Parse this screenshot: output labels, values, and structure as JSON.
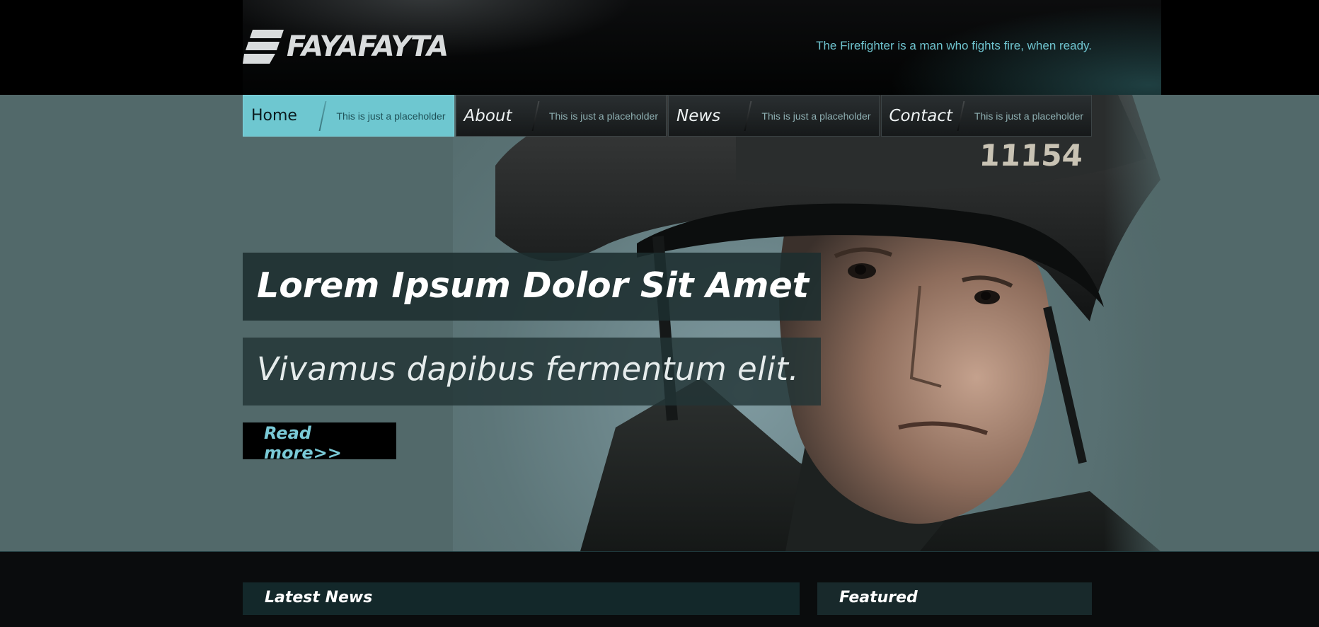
{
  "header": {
    "logo_text": "FAYAFAYTA",
    "tagline": "The Firefighter is a man who fights fire, when ready."
  },
  "nav": {
    "items": [
      {
        "label": "Home",
        "sub": "This is just a placeholder",
        "active": true
      },
      {
        "label": "About",
        "sub": "This is just a placeholder",
        "active": false
      },
      {
        "label": "News",
        "sub": "This is just a placeholder",
        "active": false
      },
      {
        "label": "Contact",
        "sub": "This is just a placeholder",
        "active": false
      }
    ]
  },
  "hero": {
    "title": "Lorem Ipsum Dolor Sit Amet",
    "subtitle": "Vivamus dapibus fermentum elit.",
    "cta_label": "Read more>>",
    "helmet_number": "11154"
  },
  "sections": {
    "latest_news_title": "Latest News",
    "featured_title": "Featured"
  },
  "colors": {
    "accent": "#6ec7d0",
    "hero_bg": "#52696a",
    "tagline": "#6fc4cf",
    "page_bg": "#0a0c0d"
  }
}
